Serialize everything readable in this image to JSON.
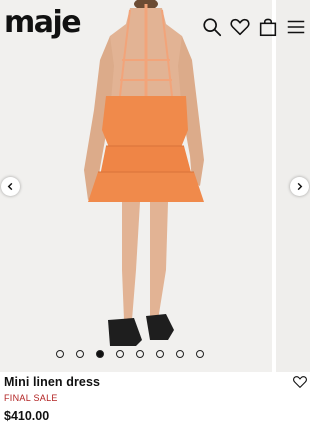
{
  "header": {
    "logo": "maje",
    "icons": [
      "search-icon",
      "heart-icon",
      "bag-icon",
      "menu-icon"
    ]
  },
  "gallery": {
    "slide_count": 8,
    "active_slide": 3,
    "prev_icon": "chevron-left-icon",
    "next_icon": "chevron-right-icon"
  },
  "product": {
    "name": "Mini linen dress",
    "badge": "FINAL SALE",
    "price": "$410.00",
    "wishlist_icon": "heart-icon"
  },
  "colors": {
    "dress": "#f08a4b",
    "background": "#f1f0ee",
    "sale_badge": "#b22222"
  }
}
